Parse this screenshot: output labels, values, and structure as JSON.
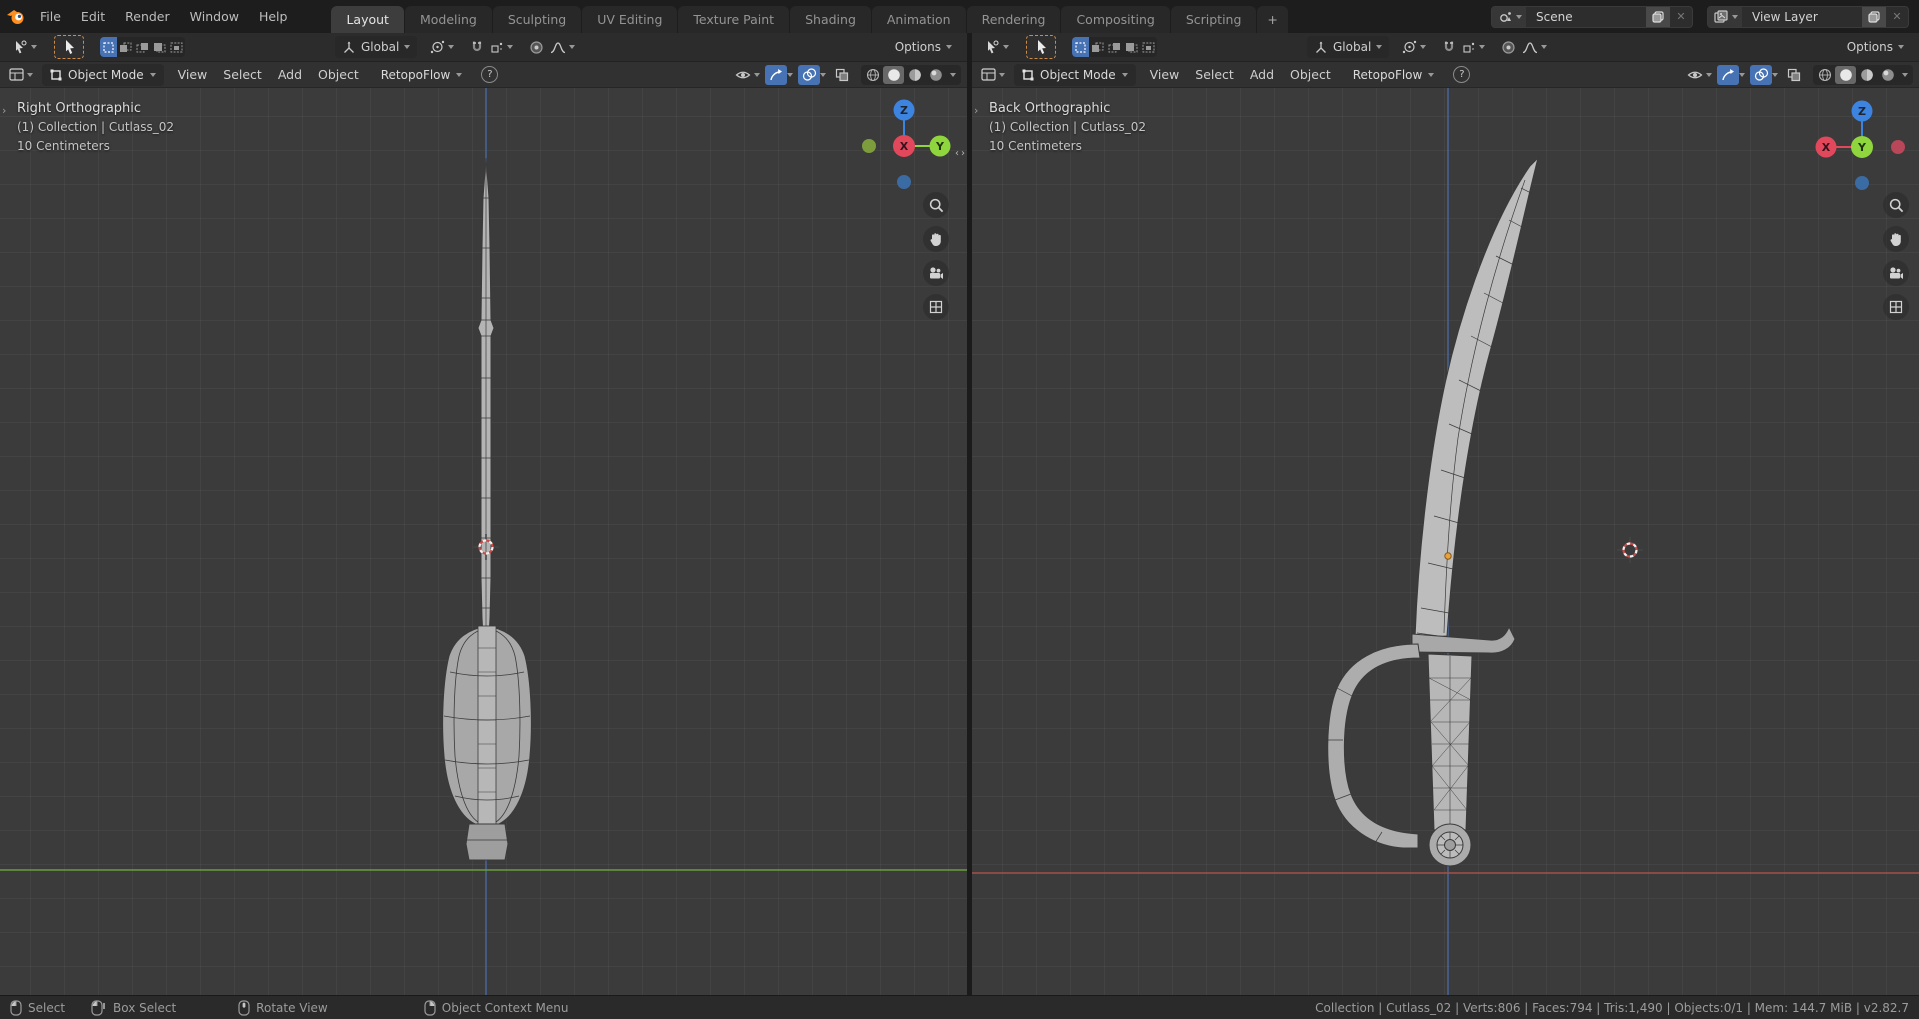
{
  "topbar": {
    "menus": [
      "File",
      "Edit",
      "Render",
      "Window",
      "Help"
    ],
    "tabs": [
      "Layout",
      "Modeling",
      "Sculpting",
      "UV Editing",
      "Texture Paint",
      "Shading",
      "Animation",
      "Rendering",
      "Compositing",
      "Scripting"
    ],
    "add_tab": "+",
    "scene_label": "Scene",
    "view_layer_label": "View Layer"
  },
  "tool_settings": {
    "orientation": "Global",
    "options": "Options"
  },
  "viewport_header": {
    "mode": "Object Mode",
    "menus": [
      "View",
      "Select",
      "Add",
      "Object"
    ],
    "retopoflow": "RetopoFlow",
    "help": "?"
  },
  "viewports": {
    "left": {
      "view": "Right Orthographic",
      "collection": "(1) Collection | Cutlass_02",
      "scale": "10 Centimeters"
    },
    "right": {
      "view": "Back Orthographic",
      "collection": "(1) Collection | Cutlass_02",
      "scale": "10 Centimeters"
    }
  },
  "axis_gizmo": {
    "x": "X",
    "y": "Y",
    "z": "Z"
  },
  "statusbar": {
    "hints": [
      "Select",
      "Box Select",
      "Rotate View",
      "Object Context Menu"
    ],
    "stats": "Collection | Cutlass_02 | Verts:806 | Faces:794 | Tris:1,490 | Objects:0/1 | Mem: 144.7 MiB | v2.82.7"
  },
  "colors": {
    "accent_blue": "#4772b3",
    "tool_outline": "#cf8a45",
    "axis_x": "#a5504a",
    "axis_y": "#6a9d3f",
    "axis_z": "#4a6ca8",
    "gizmo_x": "#e2485c",
    "gizmo_y": "#8fd53d",
    "gizmo_z": "#3d84e0",
    "viewport_bg": "#3b3b3b"
  }
}
